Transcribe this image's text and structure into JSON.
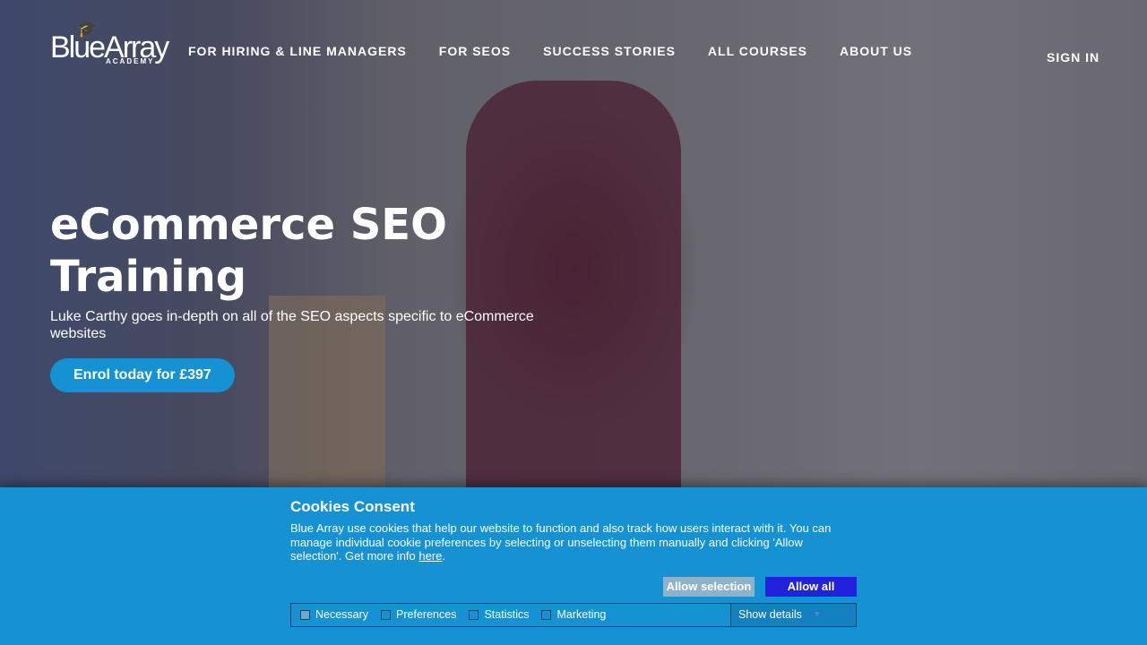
{
  "brand": {
    "name": "BlueArray",
    "sub": "ACADEMY"
  },
  "nav": {
    "items": [
      "FOR HIRING & LINE MANAGERS",
      "FOR SEOS",
      "SUCCESS STORIES",
      "ALL COURSES",
      "ABOUT US"
    ],
    "sign_in": "SIGN IN"
  },
  "hero": {
    "title": "eCommerce SEO Training",
    "subtitle": "Luke Carthy goes in-depth on all of the SEO aspects specific to eCommerce websites",
    "cta": "Enrol today for £397"
  },
  "cookies": {
    "title": "Cookies Consent",
    "text": "Blue Array use cookies that help our website to function and also track how users interact with it. You can manage individual cookie preferences by selecting or unselecting them manually and clicking 'Allow selection'. Get more info ",
    "link": "here",
    "allow_selection": "Allow selection",
    "allow_all": "Allow all",
    "options": [
      {
        "label": "Necessary",
        "checked": true
      },
      {
        "label": "Preferences",
        "checked": false
      },
      {
        "label": "Statistics",
        "checked": false
      },
      {
        "label": "Marketing",
        "checked": false
      }
    ],
    "show_details": "Show details"
  },
  "colors": {
    "accent": "#1592d4",
    "allow_all": "#2222dd"
  }
}
